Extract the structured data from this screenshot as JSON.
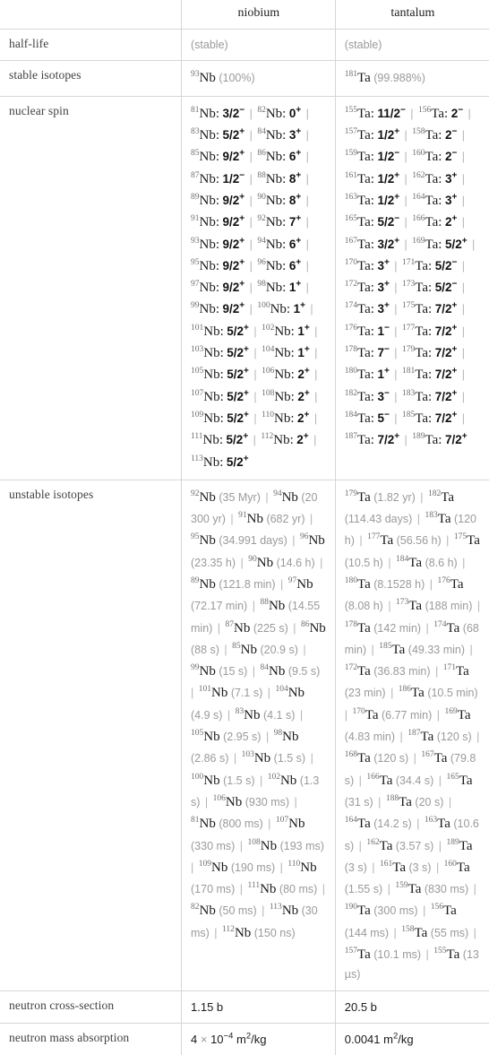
{
  "table": {
    "columns": [
      "",
      "niobium",
      "tantalum"
    ],
    "row_labels": [
      "half-life",
      "stable isotopes",
      "nuclear spin",
      "unstable isotopes",
      "neutron cross-section",
      "neutron mass absorption"
    ],
    "half_life": {
      "niobium": "(stable)",
      "tantalum": "(stable)"
    },
    "stable_isotopes": {
      "niobium": [
        {
          "mass": "93",
          "symbol": "Nb",
          "note": "(100%)"
        }
      ],
      "tantalum": [
        {
          "mass": "181",
          "symbol": "Ta",
          "note": "(99.988%)"
        }
      ]
    },
    "nuclear_spin": {
      "niobium": [
        {
          "mass": "81",
          "symbol": "Nb",
          "spin": "3/2",
          "sign": "−"
        },
        {
          "mass": "82",
          "symbol": "Nb",
          "spin": "0",
          "sign": "+"
        },
        {
          "mass": "83",
          "symbol": "Nb",
          "spin": "5/2",
          "sign": "+"
        },
        {
          "mass": "84",
          "symbol": "Nb",
          "spin": "3",
          "sign": "+"
        },
        {
          "mass": "85",
          "symbol": "Nb",
          "spin": "9/2",
          "sign": "+"
        },
        {
          "mass": "86",
          "symbol": "Nb",
          "spin": "6",
          "sign": "+"
        },
        {
          "mass": "87",
          "symbol": "Nb",
          "spin": "1/2",
          "sign": "−"
        },
        {
          "mass": "88",
          "symbol": "Nb",
          "spin": "8",
          "sign": "+"
        },
        {
          "mass": "89",
          "symbol": "Nb",
          "spin": "9/2",
          "sign": "+"
        },
        {
          "mass": "90",
          "symbol": "Nb",
          "spin": "8",
          "sign": "+"
        },
        {
          "mass": "91",
          "symbol": "Nb",
          "spin": "9/2",
          "sign": "+"
        },
        {
          "mass": "92",
          "symbol": "Nb",
          "spin": "7",
          "sign": "+"
        },
        {
          "mass": "93",
          "symbol": "Nb",
          "spin": "9/2",
          "sign": "+"
        },
        {
          "mass": "94",
          "symbol": "Nb",
          "spin": "6",
          "sign": "+"
        },
        {
          "mass": "95",
          "symbol": "Nb",
          "spin": "9/2",
          "sign": "+"
        },
        {
          "mass": "96",
          "symbol": "Nb",
          "spin": "6",
          "sign": "+"
        },
        {
          "mass": "97",
          "symbol": "Nb",
          "spin": "9/2",
          "sign": "+"
        },
        {
          "mass": "98",
          "symbol": "Nb",
          "spin": "1",
          "sign": "+"
        },
        {
          "mass": "99",
          "symbol": "Nb",
          "spin": "9/2",
          "sign": "+"
        },
        {
          "mass": "100",
          "symbol": "Nb",
          "spin": "1",
          "sign": "+"
        },
        {
          "mass": "101",
          "symbol": "Nb",
          "spin": "5/2",
          "sign": "+"
        },
        {
          "mass": "102",
          "symbol": "Nb",
          "spin": "1",
          "sign": "+"
        },
        {
          "mass": "103",
          "symbol": "Nb",
          "spin": "5/2",
          "sign": "+"
        },
        {
          "mass": "104",
          "symbol": "Nb",
          "spin": "1",
          "sign": "+"
        },
        {
          "mass": "105",
          "symbol": "Nb",
          "spin": "5/2",
          "sign": "+"
        },
        {
          "mass": "106",
          "symbol": "Nb",
          "spin": "2",
          "sign": "+"
        },
        {
          "mass": "107",
          "symbol": "Nb",
          "spin": "5/2",
          "sign": "+"
        },
        {
          "mass": "108",
          "symbol": "Nb",
          "spin": "2",
          "sign": "+"
        },
        {
          "mass": "109",
          "symbol": "Nb",
          "spin": "5/2",
          "sign": "+"
        },
        {
          "mass": "110",
          "symbol": "Nb",
          "spin": "2",
          "sign": "+"
        },
        {
          "mass": "111",
          "symbol": "Nb",
          "spin": "5/2",
          "sign": "+"
        },
        {
          "mass": "112",
          "symbol": "Nb",
          "spin": "2",
          "sign": "+"
        },
        {
          "mass": "113",
          "symbol": "Nb",
          "spin": "5/2",
          "sign": "+"
        }
      ],
      "tantalum": [
        {
          "mass": "155",
          "symbol": "Ta",
          "spin": "11/2",
          "sign": "−"
        },
        {
          "mass": "156",
          "symbol": "Ta",
          "spin": "2",
          "sign": "−"
        },
        {
          "mass": "157",
          "symbol": "Ta",
          "spin": "1/2",
          "sign": "+"
        },
        {
          "mass": "158",
          "symbol": "Ta",
          "spin": "2",
          "sign": "−"
        },
        {
          "mass": "159",
          "symbol": "Ta",
          "spin": "1/2",
          "sign": "−"
        },
        {
          "mass": "160",
          "symbol": "Ta",
          "spin": "2",
          "sign": "−"
        },
        {
          "mass": "161",
          "symbol": "Ta",
          "spin": "1/2",
          "sign": "+"
        },
        {
          "mass": "162",
          "symbol": "Ta",
          "spin": "3",
          "sign": "+"
        },
        {
          "mass": "163",
          "symbol": "Ta",
          "spin": "1/2",
          "sign": "+"
        },
        {
          "mass": "164",
          "symbol": "Ta",
          "spin": "3",
          "sign": "+"
        },
        {
          "mass": "165",
          "symbol": "Ta",
          "spin": "5/2",
          "sign": "−"
        },
        {
          "mass": "166",
          "symbol": "Ta",
          "spin": "2",
          "sign": "+"
        },
        {
          "mass": "167",
          "symbol": "Ta",
          "spin": "3/2",
          "sign": "+"
        },
        {
          "mass": "169",
          "symbol": "Ta",
          "spin": "5/2",
          "sign": "+"
        },
        {
          "mass": "170",
          "symbol": "Ta",
          "spin": "3",
          "sign": "+"
        },
        {
          "mass": "171",
          "symbol": "Ta",
          "spin": "5/2",
          "sign": "−"
        },
        {
          "mass": "172",
          "symbol": "Ta",
          "spin": "3",
          "sign": "+"
        },
        {
          "mass": "173",
          "symbol": "Ta",
          "spin": "5/2",
          "sign": "−"
        },
        {
          "mass": "174",
          "symbol": "Ta",
          "spin": "3",
          "sign": "+"
        },
        {
          "mass": "175",
          "symbol": "Ta",
          "spin": "7/2",
          "sign": "+"
        },
        {
          "mass": "176",
          "symbol": "Ta",
          "spin": "1",
          "sign": "−"
        },
        {
          "mass": "177",
          "symbol": "Ta",
          "spin": "7/2",
          "sign": "+"
        },
        {
          "mass": "178",
          "symbol": "Ta",
          "spin": "7",
          "sign": "−"
        },
        {
          "mass": "179",
          "symbol": "Ta",
          "spin": "7/2",
          "sign": "+"
        },
        {
          "mass": "180",
          "symbol": "Ta",
          "spin": "1",
          "sign": "+"
        },
        {
          "mass": "181",
          "symbol": "Ta",
          "spin": "7/2",
          "sign": "+"
        },
        {
          "mass": "182",
          "symbol": "Ta",
          "spin": "3",
          "sign": "−"
        },
        {
          "mass": "183",
          "symbol": "Ta",
          "spin": "7/2",
          "sign": "+"
        },
        {
          "mass": "184",
          "symbol": "Ta",
          "spin": "5",
          "sign": "−"
        },
        {
          "mass": "185",
          "symbol": "Ta",
          "spin": "7/2",
          "sign": "+"
        },
        {
          "mass": "187",
          "symbol": "Ta",
          "spin": "7/2",
          "sign": "+"
        },
        {
          "mass": "189",
          "symbol": "Ta",
          "spin": "7/2",
          "sign": "+"
        }
      ]
    },
    "unstable_isotopes": {
      "niobium": [
        {
          "mass": "92",
          "symbol": "Nb",
          "half_life": "(35 Myr)"
        },
        {
          "mass": "94",
          "symbol": "Nb",
          "half_life": "(20 300 yr)"
        },
        {
          "mass": "91",
          "symbol": "Nb",
          "half_life": "(682 yr)"
        },
        {
          "mass": "95",
          "symbol": "Nb",
          "half_life": "(34.991 days)"
        },
        {
          "mass": "96",
          "symbol": "Nb",
          "half_life": "(23.35 h)"
        },
        {
          "mass": "90",
          "symbol": "Nb",
          "half_life": "(14.6 h)"
        },
        {
          "mass": "89",
          "symbol": "Nb",
          "half_life": "(121.8 min)"
        },
        {
          "mass": "97",
          "symbol": "Nb",
          "half_life": "(72.17 min)"
        },
        {
          "mass": "88",
          "symbol": "Nb",
          "half_life": "(14.55 min)"
        },
        {
          "mass": "87",
          "symbol": "Nb",
          "half_life": "(225 s)"
        },
        {
          "mass": "86",
          "symbol": "Nb",
          "half_life": "(88 s)"
        },
        {
          "mass": "85",
          "symbol": "Nb",
          "half_life": "(20.9 s)"
        },
        {
          "mass": "99",
          "symbol": "Nb",
          "half_life": "(15 s)"
        },
        {
          "mass": "84",
          "symbol": "Nb",
          "half_life": "(9.5 s)"
        },
        {
          "mass": "101",
          "symbol": "Nb",
          "half_life": "(7.1 s)"
        },
        {
          "mass": "104",
          "symbol": "Nb",
          "half_life": "(4.9 s)"
        },
        {
          "mass": "83",
          "symbol": "Nb",
          "half_life": "(4.1 s)"
        },
        {
          "mass": "105",
          "symbol": "Nb",
          "half_life": "(2.95 s)"
        },
        {
          "mass": "98",
          "symbol": "Nb",
          "half_life": "(2.86 s)"
        },
        {
          "mass": "103",
          "symbol": "Nb",
          "half_life": "(1.5 s)"
        },
        {
          "mass": "100",
          "symbol": "Nb",
          "half_life": "(1.5 s)"
        },
        {
          "mass": "102",
          "symbol": "Nb",
          "half_life": "(1.3 s)"
        },
        {
          "mass": "106",
          "symbol": "Nb",
          "half_life": "(930 ms)"
        },
        {
          "mass": "81",
          "symbol": "Nb",
          "half_life": "(800 ms)"
        },
        {
          "mass": "107",
          "symbol": "Nb",
          "half_life": "(330 ms)"
        },
        {
          "mass": "108",
          "symbol": "Nb",
          "half_life": "(193 ms)"
        },
        {
          "mass": "109",
          "symbol": "Nb",
          "half_life": "(190 ms)"
        },
        {
          "mass": "110",
          "symbol": "Nb",
          "half_life": "(170 ms)"
        },
        {
          "mass": "111",
          "symbol": "Nb",
          "half_life": "(80 ms)"
        },
        {
          "mass": "82",
          "symbol": "Nb",
          "half_life": "(50 ms)"
        },
        {
          "mass": "113",
          "symbol": "Nb",
          "half_life": "(30 ms)"
        },
        {
          "mass": "112",
          "symbol": "Nb",
          "half_life": "(150 ns)"
        }
      ],
      "tantalum": [
        {
          "mass": "179",
          "symbol": "Ta",
          "half_life": "(1.82 yr)"
        },
        {
          "mass": "182",
          "symbol": "Ta",
          "half_life": "(114.43 days)"
        },
        {
          "mass": "183",
          "symbol": "Ta",
          "half_life": "(120 h)"
        },
        {
          "mass": "177",
          "symbol": "Ta",
          "half_life": "(56.56 h)"
        },
        {
          "mass": "175",
          "symbol": "Ta",
          "half_life": "(10.5 h)"
        },
        {
          "mass": "184",
          "symbol": "Ta",
          "half_life": "(8.6 h)"
        },
        {
          "mass": "180",
          "symbol": "Ta",
          "half_life": "(8.1528 h)"
        },
        {
          "mass": "176",
          "symbol": "Ta",
          "half_life": "(8.08 h)"
        },
        {
          "mass": "173",
          "symbol": "Ta",
          "half_life": "(188 min)"
        },
        {
          "mass": "178",
          "symbol": "Ta",
          "half_life": "(142 min)"
        },
        {
          "mass": "174",
          "symbol": "Ta",
          "half_life": "(68 min)"
        },
        {
          "mass": "185",
          "symbol": "Ta",
          "half_life": "(49.33 min)"
        },
        {
          "mass": "172",
          "symbol": "Ta",
          "half_life": "(36.83 min)"
        },
        {
          "mass": "171",
          "symbol": "Ta",
          "half_life": "(23 min)"
        },
        {
          "mass": "186",
          "symbol": "Ta",
          "half_life": "(10.5 min)"
        },
        {
          "mass": "170",
          "symbol": "Ta",
          "half_life": "(6.77 min)"
        },
        {
          "mass": "169",
          "symbol": "Ta",
          "half_life": "(4.83 min)"
        },
        {
          "mass": "187",
          "symbol": "Ta",
          "half_life": "(120 s)"
        },
        {
          "mass": "168",
          "symbol": "Ta",
          "half_life": "(120 s)"
        },
        {
          "mass": "167",
          "symbol": "Ta",
          "half_life": "(79.8 s)"
        },
        {
          "mass": "166",
          "symbol": "Ta",
          "half_life": "(34.4 s)"
        },
        {
          "mass": "165",
          "symbol": "Ta",
          "half_life": "(31 s)"
        },
        {
          "mass": "188",
          "symbol": "Ta",
          "half_life": "(20 s)"
        },
        {
          "mass": "164",
          "symbol": "Ta",
          "half_life": "(14.2 s)"
        },
        {
          "mass": "163",
          "symbol": "Ta",
          "half_life": "(10.6 s)"
        },
        {
          "mass": "162",
          "symbol": "Ta",
          "half_life": "(3.57 s)"
        },
        {
          "mass": "189",
          "symbol": "Ta",
          "half_life": "(3 s)"
        },
        {
          "mass": "161",
          "symbol": "Ta",
          "half_life": "(3 s)"
        },
        {
          "mass": "160",
          "symbol": "Ta",
          "half_life": "(1.55 s)"
        },
        {
          "mass": "159",
          "symbol": "Ta",
          "half_life": "(830 ms)"
        },
        {
          "mass": "190",
          "symbol": "Ta",
          "half_life": "(300 ms)"
        },
        {
          "mass": "156",
          "symbol": "Ta",
          "half_life": "(144 ms)"
        },
        {
          "mass": "158",
          "symbol": "Ta",
          "half_life": "(55 ms)"
        },
        {
          "mass": "157",
          "symbol": "Ta",
          "half_life": "(10.1 ms)"
        },
        {
          "mass": "155",
          "symbol": "Ta",
          "half_life": "(13 µs)"
        }
      ]
    },
    "neutron_cross_section": {
      "niobium": "1.15 b",
      "tantalum": "20.5 b"
    },
    "neutron_mass_absorption": {
      "niobium": {
        "mantissa": "4",
        "times": "×",
        "base": "10",
        "exponent": "−4",
        "unit": "m",
        "unit_exp": "2",
        "unit_tail": "/kg"
      },
      "tantalum": {
        "mantissa": "0.0041",
        "times": "",
        "base": "",
        "exponent": "",
        "unit": "m",
        "unit_exp": "2",
        "unit_tail": "/kg"
      }
    }
  }
}
